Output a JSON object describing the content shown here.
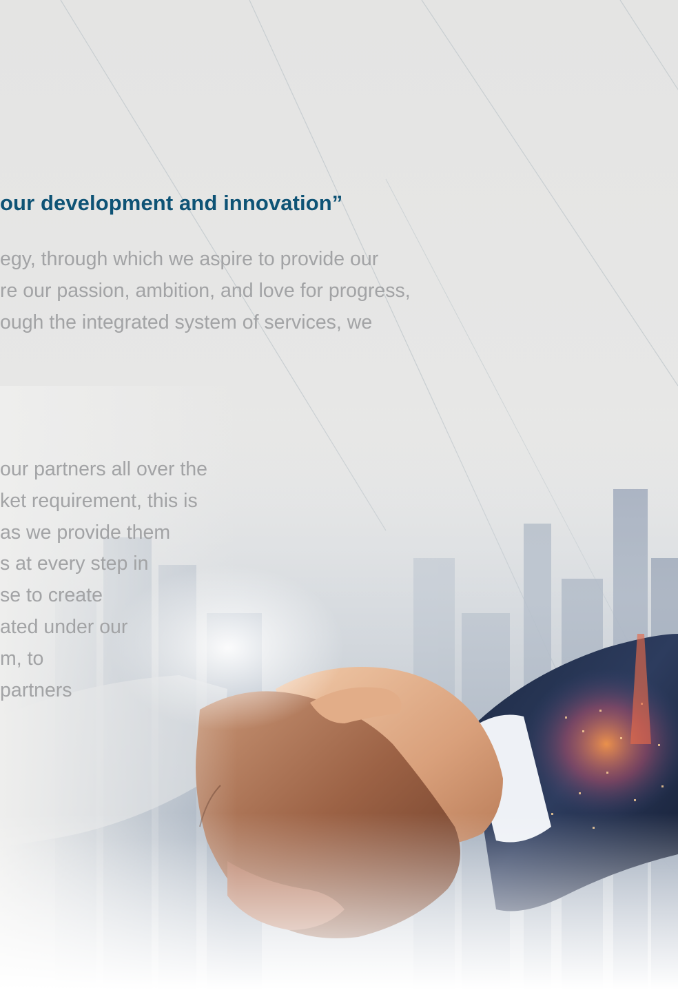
{
  "headline": "our development and innovation”",
  "paragraph_1": {
    "lines": [
      "egy, through which we aspire to provide our",
      "re our passion, ambition, and love for progress,",
      "ough the integrated system of services, we"
    ]
  },
  "paragraph_2": {
    "lines": [
      " our partners all over the",
      "ket requirement, this is",
      "as we provide them",
      "s at every step in",
      "se to create",
      "ated under our",
      "m, to",
      "partners"
    ]
  },
  "colors": {
    "headline": "#0e5375",
    "body_text": "#a2a3a5",
    "background": "#e6e6e5",
    "line_stroke": "#c9cfd1"
  }
}
